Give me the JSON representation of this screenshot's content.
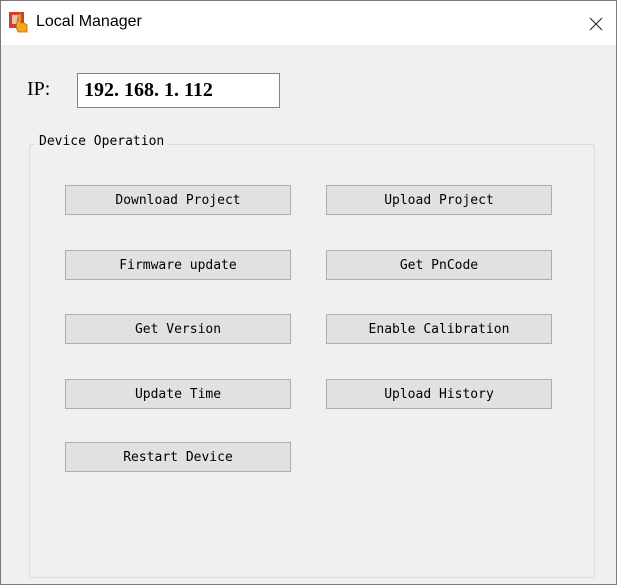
{
  "window": {
    "title": "Local Manager",
    "icon": "app-hand-icon",
    "close_icon": "close-icon"
  },
  "ip": {
    "label": "IP:",
    "value": "192. 168. 1. 112"
  },
  "device_operation": {
    "title": "Device Operation",
    "buttons": [
      {
        "label": "Download Project"
      },
      {
        "label": "Upload Project"
      },
      {
        "label": "Firmware update"
      },
      {
        "label": "Get PnCode"
      },
      {
        "label": "Get Version"
      },
      {
        "label": "Enable Calibration"
      },
      {
        "label": "Update Time"
      },
      {
        "label": "Upload History"
      },
      {
        "label": "Restart Device"
      }
    ]
  },
  "colors": {
    "icon_red": "#d83b2b",
    "icon_orange": "#f5a623",
    "input_border": "#4a90d9",
    "button_bg": "#e1e1e1"
  }
}
